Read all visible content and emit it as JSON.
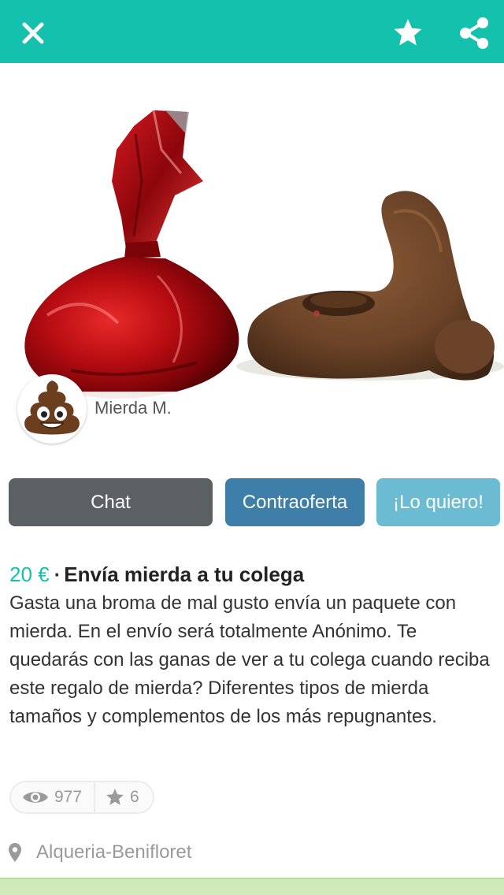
{
  "header": {
    "bg_color": "#13c1ac",
    "close_icon": "close-icon",
    "favorite_icon": "star-icon",
    "share_icon": "share-icon"
  },
  "gallery": {
    "images": [
      "red-foil-wrapped-package",
      "poop-pile"
    ]
  },
  "seller": {
    "name": "Mierda M.",
    "avatar_icon": "poop-emoji-icon"
  },
  "actions": {
    "chat_label": "Chat",
    "offer_label": "Contraoferta",
    "want_label": "¡Lo quiero!"
  },
  "product": {
    "price": "20  €",
    "separator": "·",
    "title": "Envía mierda a tu colega",
    "description": "Gasta una broma de mal gusto envía un paquete con mierda.  En el envío será totalmente Anónimo. Te quedarás con las ganas de ver a tu colega cuando reciba este regalo de mierda?  Diferentes tipos de mierda tamaños y complementos de los más repugnantes."
  },
  "stats": {
    "views": "977",
    "favorites": "6"
  },
  "location": {
    "text": "Alqueria-Benifloret"
  },
  "colors": {
    "accent": "#13c1ac",
    "chat_button": "#5b6063",
    "offer_button": "#3d7fa8",
    "want_button": "#6bbbd3"
  }
}
